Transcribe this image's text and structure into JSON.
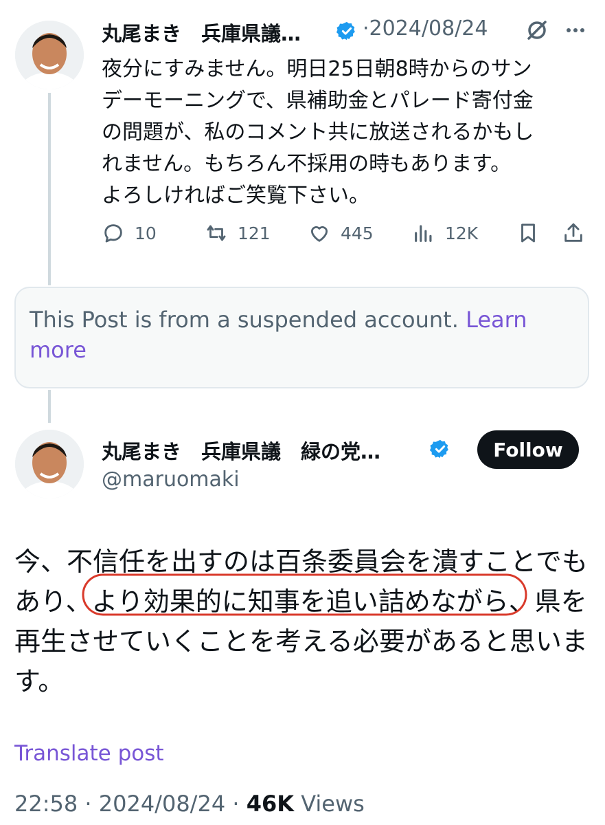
{
  "post1": {
    "display_name": "丸尾まき　兵庫県議…",
    "date": "2024/08/24",
    "body_lines": [
      "夜分にすみません。明日25日朝8時からのサン",
      "デーモーニングで、県補助金とパレード寄付金",
      "の問題が、私のコメント共に放送されるかもし",
      "れません。もちろん不採用の時もあります。",
      "よろしければご笑覧下さい。"
    ],
    "actions": {
      "replies": "10",
      "reposts": "121",
      "likes": "445",
      "views": "12K"
    }
  },
  "suspended": {
    "text": "This Post is from a suspended account.",
    "link": "Learn more"
  },
  "post2": {
    "display_name": "丸尾まき　兵庫県議　緑の党…",
    "handle": "@maruomaki",
    "follow_label": "Follow",
    "line1": "今、不信任を出すのは百条委員会を潰すことでも",
    "line2_before": "あり、",
    "line2_highlight": "より効果的に知事を追い詰めながら、",
    "line2_after": "県を",
    "line3": "再生させていくことを考える必要があると思いま",
    "line4": "す。",
    "translate_label": "Translate post",
    "time": "22:58",
    "date": "2024/08/24",
    "views_count": "46K",
    "views_label": "Views"
  },
  "colors": {
    "text": "#0f1419",
    "secondary": "#536471",
    "verified": "#1d9bf0",
    "link": "#7856d6",
    "highlight_circle": "#d93a2b"
  }
}
